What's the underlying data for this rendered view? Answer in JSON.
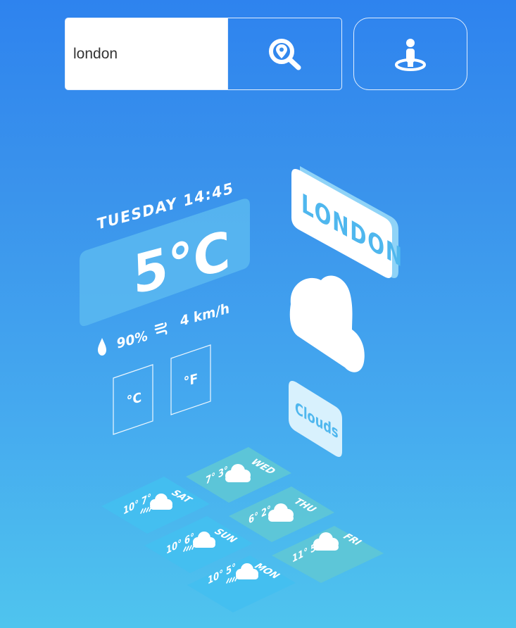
{
  "search": {
    "value": "london",
    "icon": "map-pin-magnifier-icon"
  },
  "locate": {
    "icon": "person-location-icon"
  },
  "current": {
    "datetime": "TUESDAY 14:45",
    "temperature": "5°C",
    "humidity": "90%",
    "wind": "4 km/h",
    "unit_c": "°C",
    "unit_f": "°F"
  },
  "location": {
    "city": "LONDON"
  },
  "condition": {
    "label": "Clouds",
    "icon": "cloud-icon"
  },
  "forecast": [
    {
      "day": "WED",
      "temps": "7° 3°",
      "icon": "cloud-icon"
    },
    {
      "day": "THU",
      "temps": "6° 2°",
      "icon": "cloud-icon"
    },
    {
      "day": "FRI",
      "temps": "11° 5°",
      "icon": "cloud-icon"
    },
    {
      "day": "SAT",
      "temps": "10° 7°",
      "icon": "rain-cloud-icon"
    },
    {
      "day": "SUN",
      "temps": "10° 6°",
      "icon": "rain-cloud-icon"
    },
    {
      "day": "MON",
      "temps": "10° 5°",
      "icon": "rain-cloud-icon"
    }
  ],
  "colors": {
    "tile_teal": "#5ec7d6",
    "tile_blue": "#43bff0",
    "accent_text": "#4fb7ee"
  }
}
